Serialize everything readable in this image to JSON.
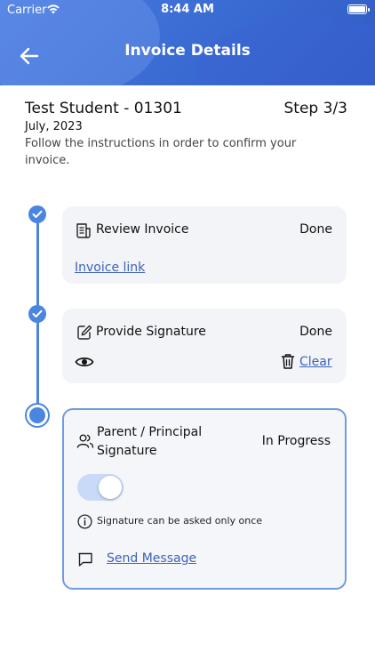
{
  "status_bar": {
    "carrier": "Carrier",
    "time": "8:44 AM"
  },
  "header": {
    "title": "Invoice Details"
  },
  "info": {
    "student": "Test Student - 01301",
    "step": "Step 3/3",
    "date": "July, 2023",
    "instructions": "Follow the instructions in order to confirm your invoice."
  },
  "steps": [
    {
      "title": "Review Invoice",
      "status": "Done",
      "link": "Invoice link"
    },
    {
      "title": "Provide Signature",
      "status": "Done",
      "clear_label": "Clear"
    },
    {
      "title_line1": "Parent / Principal",
      "title_line2": "Signature",
      "status": "In Progress",
      "toggle_on": true,
      "note": "Signature can be asked only once",
      "send_label": "Send Message"
    }
  ],
  "colors": {
    "accent": "#4a86e0",
    "header": "#3d6fd6",
    "link": "#3b63b8",
    "card": "#f3f4f8"
  }
}
